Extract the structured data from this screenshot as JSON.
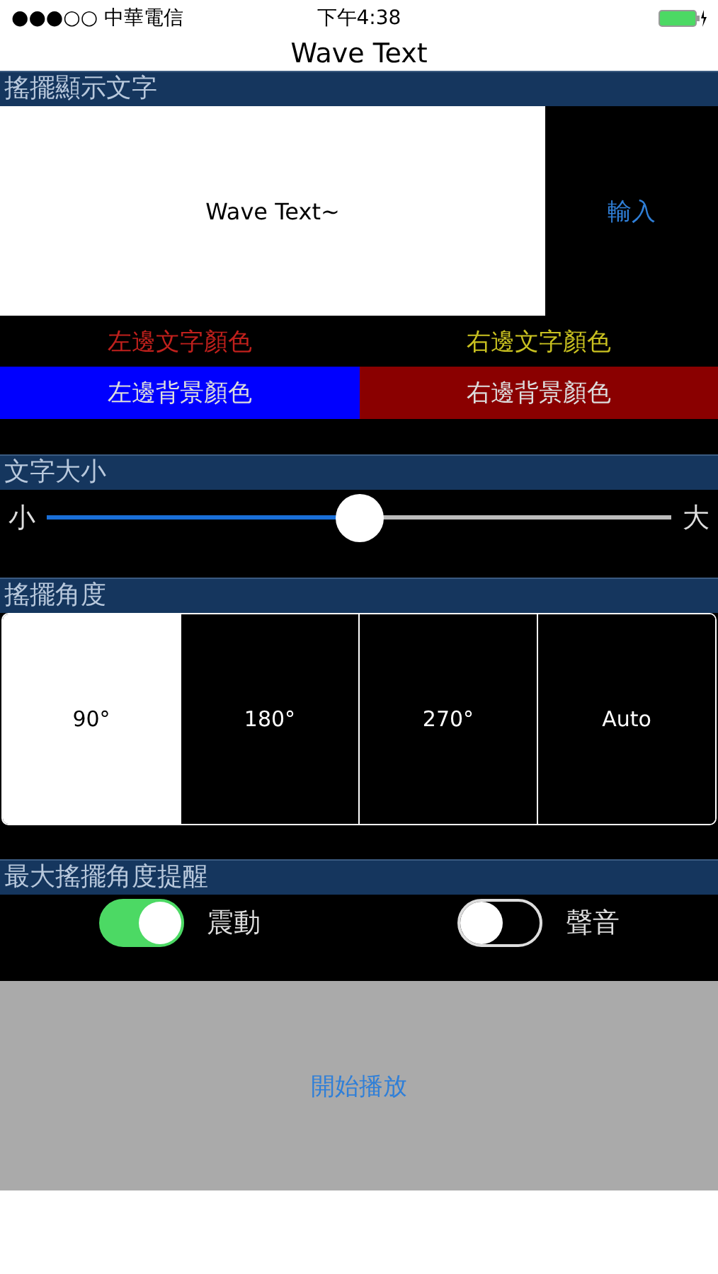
{
  "status_bar": {
    "carrier": "●●●○○ 中華電信",
    "time": "下午4:38"
  },
  "nav": {
    "title": "Wave Text"
  },
  "text_section": {
    "header": "搖擺顯示文字",
    "preview": "Wave Text~",
    "input_button": "輸入"
  },
  "text_colors": [
    {
      "label": "左邊文字顏色",
      "color": "#c0201c"
    },
    {
      "label": "右邊文字顏色",
      "color": "#c8c020"
    }
  ],
  "background_colors": [
    {
      "label": "左邊背景顏色",
      "color": "#0000ff"
    },
    {
      "label": "右邊背景顏色",
      "color": "#8a0000"
    }
  ],
  "size_section": {
    "header": "文字大小",
    "min_label": "小",
    "max_label": "大",
    "level": 0.5
  },
  "angle_section": {
    "header": "搖擺角度",
    "segments": [
      {
        "label": "90°",
        "selected": true
      },
      {
        "label": "180°",
        "selected": false
      },
      {
        "label": "270°",
        "selected": false
      },
      {
        "label": "Auto",
        "selected": false
      }
    ]
  },
  "alert_section": {
    "header": "最大搖擺角度提醒",
    "toggles": [
      {
        "label": "震動",
        "on": true
      },
      {
        "label": "聲音",
        "on": false
      }
    ]
  },
  "start_button": "開始播放"
}
